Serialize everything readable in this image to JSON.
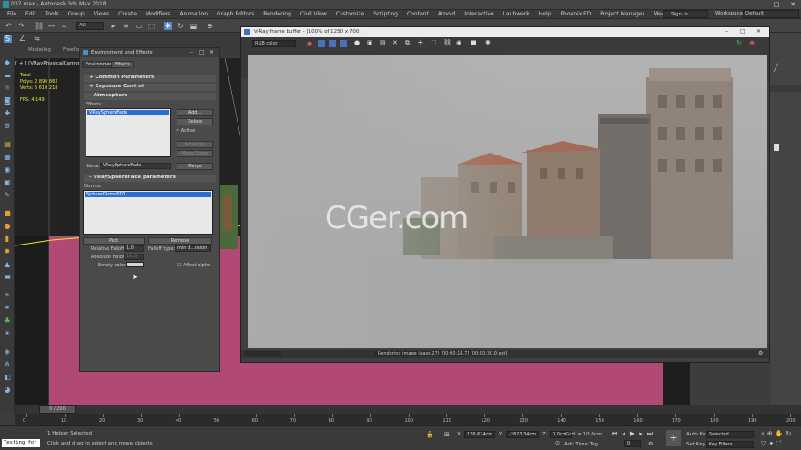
{
  "window": {
    "title": "007.max - Autodesk 3ds Max 2018"
  },
  "menubar": {
    "items": [
      "File",
      "Edit",
      "Tools",
      "Group",
      "Views",
      "Create",
      "Modifiers",
      "Animation",
      "Graph Editors",
      "Rendering",
      "Civil View",
      "Customize",
      "Scripting",
      "Content",
      "Arnold",
      "Interactive",
      "Laubwerk",
      "Help",
      "Phoenix FD",
      "Project Manager",
      "Megascans"
    ],
    "sign_in": "Sign In",
    "workspaces_label": "Workspaces:",
    "workspace": "Default"
  },
  "toolbar": {
    "selection_filter": "All"
  },
  "ribbon": {
    "tabs": [
      "Modeling",
      "Freeform"
    ]
  },
  "viewport": {
    "label": "[ + ] [VRayPhysicalCamera004",
    "stats": {
      "total_label": "Total",
      "polys_label": "Polys:",
      "polys": "2 890 862",
      "verts_label": "Verts:",
      "verts": "5 610 218",
      "fps_label": "FPS:",
      "fps": "4,149"
    }
  },
  "env_dialog": {
    "title": "Environment and Effects",
    "tabs": [
      "Environment",
      "Effects"
    ],
    "rollouts": {
      "common": "Common Parameters",
      "exposure": "Exposure Control",
      "atmosphere": "Atmosphere",
      "spherefade": "VRaySphereFade parameters"
    },
    "effects_label": "Effects:",
    "effects_list": [
      "VRaySphereFade"
    ],
    "buttons": {
      "add": "Add...",
      "delete": "Delete",
      "move_up": "Move Up",
      "move_down": "Move Down",
      "merge": "Merge",
      "pick": "Pick",
      "remove": "Remove"
    },
    "active_label": "Active",
    "name_label": "Name:",
    "name_value": "VRaySphereFade",
    "gizmos_label": "Gizmos:",
    "gizmos_list": [
      "SphereGizmo001"
    ],
    "relative_falloff_label": "Relative Falloff:",
    "relative_falloff": "1,0",
    "falloff_type_label": "Falloff type:",
    "falloff_type": "min d...nsion",
    "absolute_falloff_label": "Absolute Falloff:",
    "absolute_falloff": "10,0",
    "empty_color_label": "Empty color:",
    "affect_alpha_label": "Affect alpha",
    "colors": {
      "empty_color": "#d4d4d4"
    }
  },
  "vfb": {
    "title": "V-Ray frame buffer - [100% of 1250 x 700]",
    "channel": "RGB color",
    "status": "Rendering image (pass 27) [00:00:14,7] [00:00:30,0 est]"
  },
  "watermark": "CGer.com",
  "timeline": {
    "frame": "0 / 200",
    "ticks": [
      "0",
      "10",
      "20",
      "30",
      "40",
      "50",
      "60",
      "70",
      "80",
      "90",
      "100",
      "110",
      "120",
      "130",
      "140",
      "150",
      "160",
      "170",
      "180",
      "190",
      "200"
    ]
  },
  "statusbar": {
    "maxscript": "Testing for",
    "selection": "1 Helper Selected",
    "prompt": "Click and drag to select and move objects",
    "x_label": "X:",
    "x": "126,624cm",
    "y_label": "Y:",
    "y": "-2823,34cm",
    "z_label": "Z:",
    "z": "0,0cm",
    "grid": "Grid = 10,0cm",
    "add_time_tag": "Add Time Tag",
    "auto_key": "Auto Key",
    "set_key": "Set Key",
    "selected": "Selected",
    "key_filters": "Key Filters..."
  }
}
